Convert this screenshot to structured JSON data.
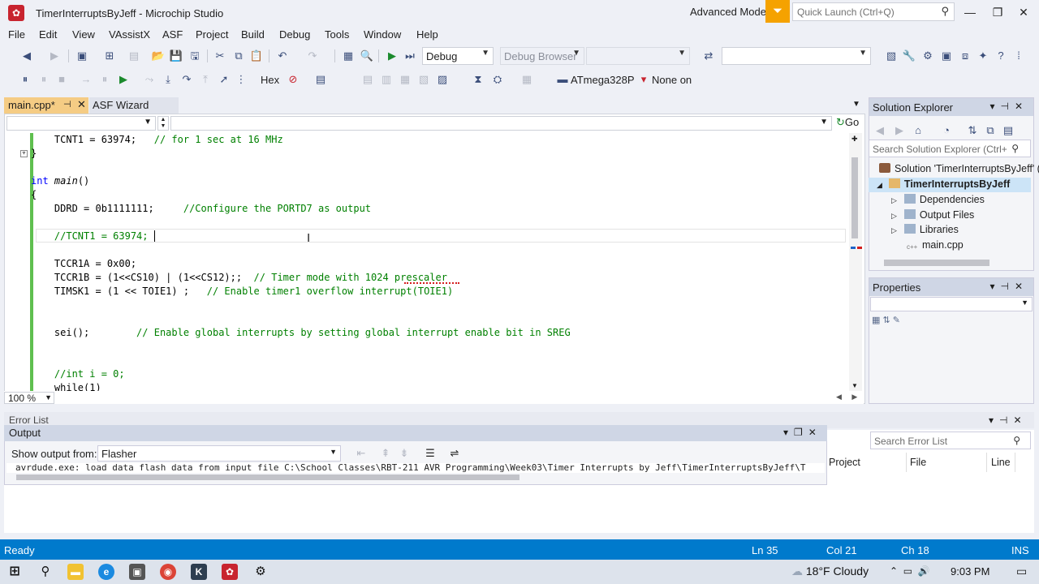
{
  "window": {
    "title": "TimerInterruptsByJeff - Microchip Studio",
    "mode": "Advanced Mode",
    "quick_launch_placeholder": "Quick Launch (Ctrl+Q)",
    "controls": {
      "minimize": "—",
      "maximize": "❐",
      "close": "✕"
    }
  },
  "menu": [
    "File",
    "Edit",
    "View",
    "VAssistX",
    "ASF",
    "Project",
    "Build",
    "Debug",
    "Tools",
    "Window",
    "Help"
  ],
  "toolbar1": {
    "config": "Debug",
    "debug_browser": "Debug Browser"
  },
  "toolbar2": {
    "hex_label": "Hex",
    "device": "ATmega328P",
    "tool": "None on"
  },
  "tabs": {
    "active": "main.cpp*",
    "other": "ASF Wizard"
  },
  "editor": {
    "go_label": "Go",
    "zoom": "100 %",
    "lines": [
      {
        "code": "    TCNT1 = 63974;",
        "comment": "   // for 1 sec at 16 MHz"
      },
      {
        "code": "}",
        "comment": ""
      },
      {
        "code": "",
        "comment": ""
      },
      {
        "code": "int main()",
        "comment": ""
      },
      {
        "code": "{",
        "comment": ""
      },
      {
        "code": "    DDRD = 0b1111111;",
        "comment": "     //Configure the PORTD7 as output"
      },
      {
        "code": "",
        "comment": ""
      },
      {
        "code": "    ",
        "comment": "//TCNT1 = 63974;"
      },
      {
        "code": "",
        "comment": ""
      },
      {
        "code": "    TCCR1A = 0x00;",
        "comment": ""
      },
      {
        "code": "    TCCR1B = (1<<CS10) | (1<<CS12);;",
        "comment": "  // Timer mode with 1024 prescaler"
      },
      {
        "code": "    TIMSK1 = (1 << TOIE1) ;",
        "comment": "   // Enable timer1 overflow interrupt(TOIE1)"
      },
      {
        "code": "",
        "comment": ""
      },
      {
        "code": "    sei();",
        "comment": "        // Enable global interrupts by setting global interrupt enable bit in SREG"
      },
      {
        "code": "",
        "comment": ""
      },
      {
        "code": "    ",
        "comment": "//int i = 0;"
      },
      {
        "code": "    while(1)",
        "comment": ""
      }
    ]
  },
  "solution_explorer": {
    "title": "Solution Explorer",
    "search_placeholder": "Search Solution Explorer (Ctrl+",
    "solution": "Solution 'TimerInterruptsByJeff' (",
    "project": "TimerInterruptsByJeff",
    "items": [
      "Dependencies",
      "Output Files",
      "Libraries",
      "main.cpp"
    ]
  },
  "properties": {
    "title": "Properties"
  },
  "error_list": {
    "title": "Error List",
    "search_placeholder": "Search Error List",
    "columns": [
      "Project",
      "File",
      "Line"
    ]
  },
  "output": {
    "title": "Output",
    "show_from_label": "Show output from:",
    "source": "Flasher",
    "text": "avrdude.exe: load data flash data from input file C:\\School Classes\\RBT-211 AVR Programming\\Week03\\Timer Interrupts by Jeff\\TimerInterruptsByJeff\\T"
  },
  "status": {
    "ready": "Ready",
    "ln": "Ln 35",
    "col": "Col 21",
    "ch": "Ch 18",
    "ins": "INS"
  },
  "taskbar": {
    "weather": "18°F  Cloudy",
    "time": "9:03 PM"
  },
  "colors": {
    "accent": "#007acc",
    "active_tab": "#f5cc84",
    "comment": "#008000",
    "keyword": "#0000ff",
    "brand": "#c8242f"
  }
}
